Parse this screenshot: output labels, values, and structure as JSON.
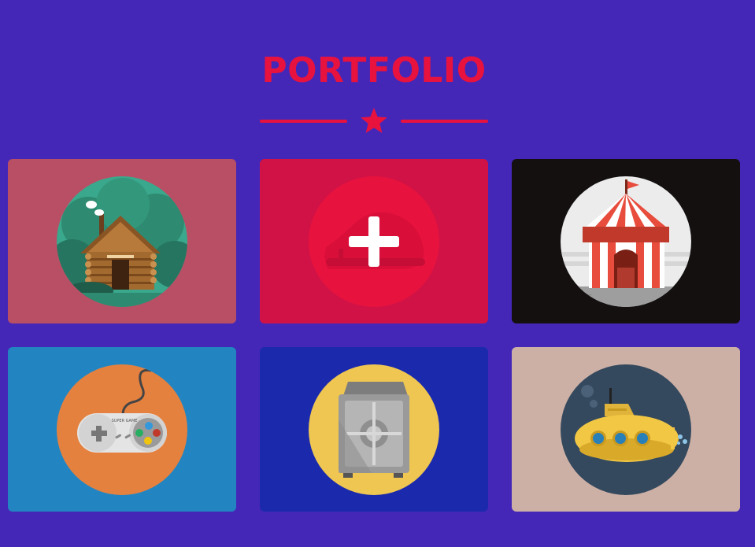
{
  "header": {
    "title": "PORTFOLIO",
    "divider_icon": "star-icon"
  },
  "colors": {
    "background": "#4527b8",
    "accent": "#e8123e"
  },
  "portfolio": {
    "items": [
      {
        "icon": "log-cabin-icon",
        "background": "#b94f65",
        "circle": "#3aa88c",
        "hovered": false
      },
      {
        "icon": "sneaker-icon",
        "background": "#d01246",
        "circle": "#e8123e",
        "hovered": true,
        "overlay_icon": "plus-icon"
      },
      {
        "icon": "circus-tent-icon",
        "background": "#141010",
        "circle": "#ececec",
        "hovered": false
      },
      {
        "icon": "game-controller-icon",
        "background": "#2285c2",
        "circle": "#e5813f",
        "hovered": false,
        "controller_label": "SUPER GAME"
      },
      {
        "icon": "safe-icon",
        "background": "#1b2aad",
        "circle": "#eec651",
        "hovered": false
      },
      {
        "icon": "submarine-icon",
        "background": "#cdb0a5",
        "circle": "#34495e",
        "hovered": false
      }
    ]
  }
}
